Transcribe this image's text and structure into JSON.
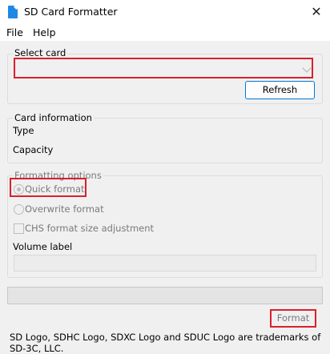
{
  "window": {
    "title": "SD Card Formatter",
    "close_glyph": "✕"
  },
  "menu": {
    "items": [
      "File",
      "Help"
    ]
  },
  "select_card": {
    "legend": "Select card",
    "selected_value": "",
    "refresh_label": "Refresh"
  },
  "card_info": {
    "legend": "Card information",
    "type_label": "Type",
    "capacity_label": "Capacity"
  },
  "formatting_options": {
    "legend": "Formatting options",
    "quick_format": "Quick format",
    "overwrite_format": "Overwrite format",
    "chs_adjustment": "CHS format size adjustment",
    "volume_label": "Volume label",
    "volume_value": ""
  },
  "actions": {
    "format_label": "Format"
  },
  "footer": {
    "trademark": "SD Logo, SDHC Logo, SDXC Logo and SDUC Logo are trademarks of SD-3C, LLC."
  },
  "colors": {
    "accent": "#0078d7",
    "highlight_box": "#d9202d",
    "app_icon": "#1e88e5"
  },
  "icons": {
    "app": "sd-card-icon",
    "close": "close-icon",
    "combo": "chevron-down-icon"
  },
  "progress": {
    "value": 0
  }
}
